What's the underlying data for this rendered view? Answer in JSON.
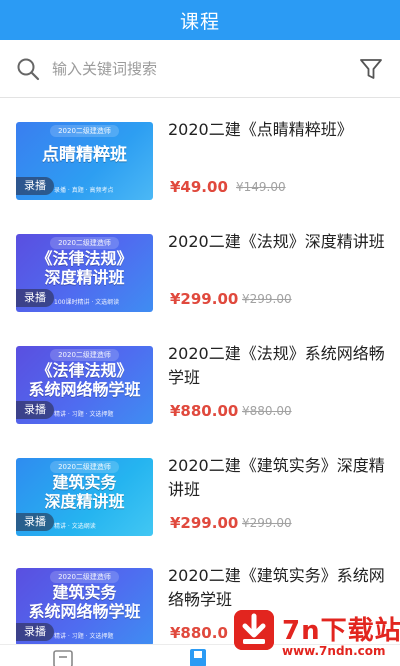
{
  "header": {
    "title": "课程"
  },
  "search": {
    "placeholder": "输入关键词搜索"
  },
  "icons": {
    "search": "search-icon",
    "filter": "filter-icon"
  },
  "colors": {
    "accent": "#2b9bf4",
    "price": "#e0493d",
    "watermark": "#e2251f"
  },
  "courses": [
    {
      "title": "2020二建《点睛精粹班》",
      "price": "¥49.00",
      "original_price": "¥149.00",
      "badge": "录播",
      "thumb": {
        "year": "2020二级建造师",
        "line1": "点睛精粹班",
        "line2": "",
        "sub": "录播 · 真题 · 高频考点"
      }
    },
    {
      "title": "2020二建《法规》深度精讲班",
      "price": "¥299.00",
      "original_price": "¥299.00",
      "badge": "录播",
      "thumb": {
        "year": "2020二级建造师",
        "line1": "《法律法规》",
        "line2": "深度精讲班",
        "sub": "100课时精讲 · 文选纲读"
      }
    },
    {
      "title": "2020二建《法规》系统网络畅学班",
      "price": "¥880.00",
      "original_price": "¥880.00",
      "badge": "录播",
      "thumb": {
        "year": "2020二级建造师",
        "line1": "《法律法规》",
        "line2": "系统网络畅学班",
        "sub": "精讲 · 习题 · 文选押题"
      }
    },
    {
      "title": "2020二建《建筑实务》深度精讲班",
      "price": "¥299.00",
      "original_price": "¥299.00",
      "badge": "录播",
      "thumb": {
        "year": "2020二级建造师",
        "line1": "建筑实务",
        "line2": "深度精讲班",
        "sub": "精讲 · 文选纲读"
      }
    },
    {
      "title": "2020二建《建筑实务》系统网络畅学班",
      "price": "¥880.0",
      "original_price": "",
      "badge": "录播",
      "thumb": {
        "year": "2020二级建造师",
        "line1": "建筑实务",
        "line2": "系统网络畅学班",
        "sub": "精讲 · 习题 · 文选押题"
      }
    }
  ],
  "watermark": {
    "name": "7n下载站",
    "url": "www.7ndn.com"
  }
}
